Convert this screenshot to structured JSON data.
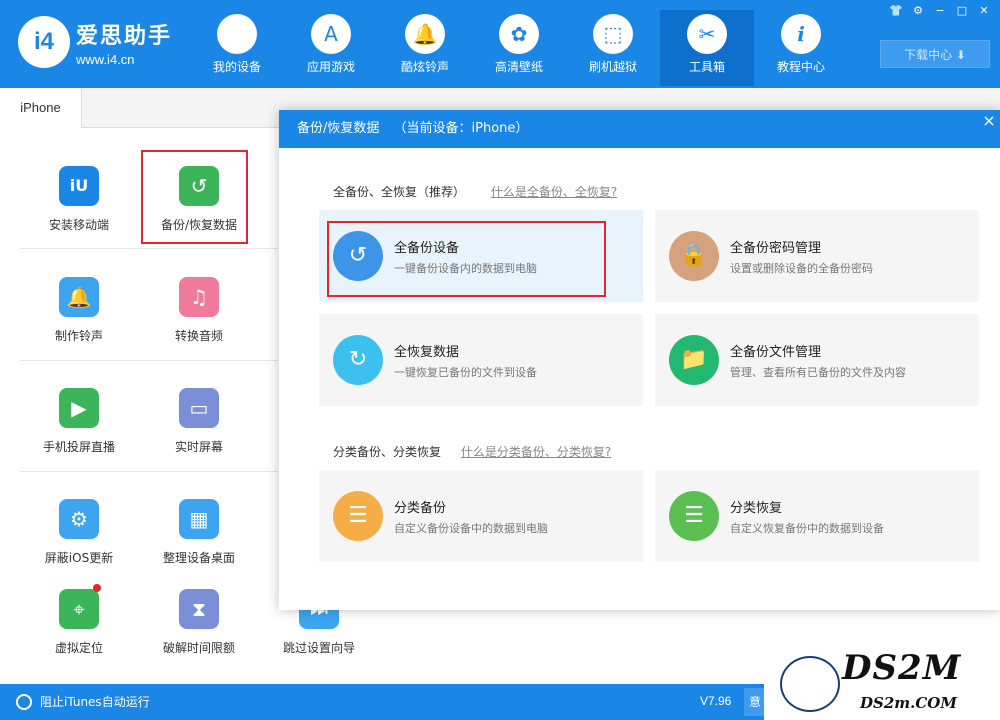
{
  "app": {
    "brand_name": "爱思助手",
    "brand_url": "www.i4.cn",
    "logo_text": "i4",
    "logo_icon": "i4-logo-icon"
  },
  "nav": [
    {
      "label": "我的设备",
      "icon": "apple-icon",
      "glyph": ""
    },
    {
      "label": "应用游戏",
      "icon": "appstore-icon",
      "glyph": "A"
    },
    {
      "label": "酷炫铃声",
      "icon": "bell-icon",
      "glyph": "🔔"
    },
    {
      "label": "高清壁纸",
      "icon": "flower-icon",
      "glyph": "✿"
    },
    {
      "label": "刷机越狱",
      "icon": "box-icon",
      "glyph": "⬚"
    },
    {
      "label": "工具箱",
      "icon": "tools-icon",
      "glyph": "✂"
    },
    {
      "label": "教程中心",
      "icon": "info-icon",
      "glyph": "i"
    }
  ],
  "nav_active": "工具箱",
  "window_controls": {
    "skin": "👕",
    "settings": "⚙",
    "minimize": "−",
    "maximize": "□",
    "close": "✕"
  },
  "download_center": "下载中心 ⬇",
  "device_tab": "iPhone",
  "tools": [
    {
      "label": "安装移动端",
      "icon": "i4-app-icon",
      "glyph": "iU",
      "color": "#1a87e6"
    },
    {
      "label": "备份/恢复数据",
      "icon": "backup-restore-icon",
      "glyph": "↺",
      "color": "#3cb55a"
    },
    {
      "label": "制作铃声",
      "icon": "bell-plus-icon",
      "glyph": "🔔",
      "color": "#3da5f0"
    },
    {
      "label": "转换音频",
      "icon": "music-note-icon",
      "glyph": "♫",
      "color": "#f07a9c"
    },
    {
      "label": "手机投屏直播",
      "icon": "screen-cast-icon",
      "glyph": "▶",
      "color": "#3cb55a"
    },
    {
      "label": "实时屏幕",
      "icon": "monitor-icon",
      "glyph": "▭",
      "color": "#7a8fd6"
    },
    {
      "label": "屏蔽iOS更新",
      "icon": "gear-block-icon",
      "glyph": "⚙",
      "color": "#3da5f0"
    },
    {
      "label": "整理设备桌面",
      "icon": "grid-icon",
      "glyph": "▦",
      "color": "#3da5f0"
    },
    {
      "label": "虚拟定位",
      "icon": "location-pin-icon",
      "glyph": "⌖",
      "color": "#3cb55a"
    },
    {
      "label": "破解时间限额",
      "icon": "hourglass-icon",
      "glyph": "⧗",
      "color": "#7a8fd6"
    },
    {
      "label": "跳过设置向导",
      "icon": "skip-wizard-icon",
      "glyph": "⏭",
      "color": "#3da5f0"
    }
  ],
  "dialog": {
    "title": "备份/恢复数据",
    "device_info": "（当前设备：iPhone）",
    "close": "×",
    "section1": {
      "title": "全备份、全恢复（推荐）",
      "link": "什么是全备份、全恢复?"
    },
    "section2": {
      "title": "分类备份、分类恢复",
      "link": "什么是分类备份、分类恢复?"
    },
    "cards": [
      {
        "title": "全备份设备",
        "desc": "一键备份设备内的数据到电脑",
        "icon": "full-backup-icon",
        "glyph": "↺",
        "color": "#3d95e8"
      },
      {
        "title": "全备份密码管理",
        "desc": "设置或删除设备的全备份密码",
        "icon": "lock-icon",
        "glyph": "🔒",
        "color": "#d6a27e"
      },
      {
        "title": "全恢复数据",
        "desc": "一键恢复已备份的文件到设备",
        "icon": "full-restore-icon",
        "glyph": "↻",
        "color": "#3cc1ef"
      },
      {
        "title": "全备份文件管理",
        "desc": "管理、查看所有已备份的文件及内容",
        "icon": "folder-icon",
        "glyph": "📁",
        "color": "#22b870"
      },
      {
        "title": "分类备份",
        "desc": "自定义备份设备中的数据到电脑",
        "icon": "category-backup-icon",
        "glyph": "☰",
        "color": "#f5ad45"
      },
      {
        "title": "分类恢复",
        "desc": "自定义恢复备份中的数据到设备",
        "icon": "category-restore-icon",
        "glyph": "☰",
        "color": "#5bbf52"
      }
    ]
  },
  "status": {
    "itunes_block": "阻止iTunes自动运行",
    "version": "V7.96",
    "extra": "意"
  },
  "watermark": {
    "text": "DS2M",
    "sub": "DS2m.COM"
  },
  "colors": {
    "primary": "#1a87e6",
    "highlight_border": "#e0282c"
  }
}
